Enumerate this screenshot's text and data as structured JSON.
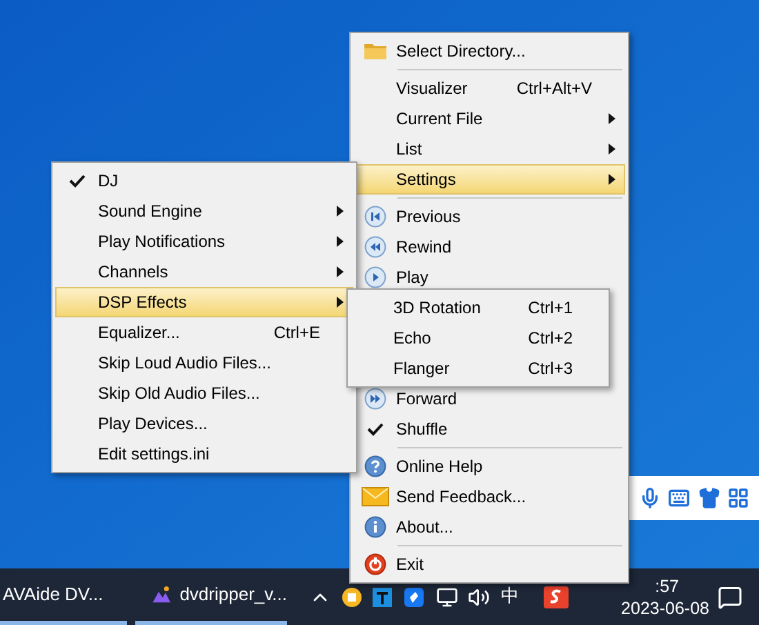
{
  "main_menu": {
    "items": [
      {
        "kind": "item",
        "label": "Select Directory...",
        "submenu": false,
        "checked": false,
        "selected": false
      },
      {
        "kind": "separator"
      },
      {
        "kind": "item",
        "label": "Visualizer",
        "shortcut": "Ctrl+Alt+V",
        "submenu": false,
        "checked": false,
        "selected": false
      },
      {
        "kind": "item",
        "label": "Current File",
        "submenu": true,
        "checked": false,
        "selected": false
      },
      {
        "kind": "item",
        "label": "List",
        "submenu": true,
        "checked": false,
        "selected": false
      },
      {
        "kind": "item",
        "label": "Settings",
        "submenu": true,
        "checked": false,
        "selected": true
      },
      {
        "kind": "separator"
      },
      {
        "kind": "item",
        "label": "Previous",
        "submenu": false,
        "checked": false,
        "selected": false
      },
      {
        "kind": "item",
        "label": "Rewind",
        "submenu": false,
        "checked": false,
        "selected": false
      },
      {
        "kind": "item",
        "label": "Play",
        "submenu": false,
        "checked": false,
        "selected": false
      },
      {
        "kind": "item",
        "label": "Forward",
        "submenu": false,
        "checked": false,
        "selected": false
      },
      {
        "kind": "item",
        "label": "Shuffle",
        "submenu": false,
        "checked": true,
        "selected": false
      },
      {
        "kind": "separator"
      },
      {
        "kind": "item",
        "label": "Online Help",
        "submenu": false,
        "checked": false,
        "selected": false
      },
      {
        "kind": "item",
        "label": "Send Feedback...",
        "submenu": false,
        "checked": false,
        "selected": false
      },
      {
        "kind": "item",
        "label": "About...",
        "submenu": false,
        "checked": false,
        "selected": false
      },
      {
        "kind": "separator"
      },
      {
        "kind": "item",
        "label": "Exit",
        "submenu": false,
        "checked": false,
        "selected": false
      }
    ]
  },
  "settings_menu": {
    "items": [
      {
        "kind": "item",
        "label": "DJ",
        "submenu": false,
        "checked": true,
        "selected": false
      },
      {
        "kind": "item",
        "label": "Sound Engine",
        "submenu": true,
        "checked": false,
        "selected": false
      },
      {
        "kind": "item",
        "label": "Play Notifications",
        "submenu": true,
        "checked": false,
        "selected": false
      },
      {
        "kind": "item",
        "label": "Channels",
        "submenu": true,
        "checked": false,
        "selected": false
      },
      {
        "kind": "item",
        "label": "DSP Effects",
        "submenu": true,
        "checked": false,
        "selected": true
      },
      {
        "kind": "item",
        "label": "Equalizer...",
        "shortcut": "Ctrl+E",
        "submenu": false,
        "checked": false,
        "selected": false
      },
      {
        "kind": "item",
        "label": "Skip Loud Audio Files...",
        "submenu": false,
        "checked": false,
        "selected": false
      },
      {
        "kind": "item",
        "label": "Skip Old Audio Files...",
        "submenu": false,
        "checked": false,
        "selected": false
      },
      {
        "kind": "item",
        "label": "Play Devices...",
        "submenu": false,
        "checked": false,
        "selected": false
      },
      {
        "kind": "item",
        "label": "Edit settings.ini",
        "submenu": false,
        "checked": false,
        "selected": false
      }
    ]
  },
  "dsp_menu": {
    "items": [
      {
        "kind": "item",
        "label": "3D Rotation",
        "shortcut": "Ctrl+1",
        "submenu": false,
        "checked": false,
        "selected": false
      },
      {
        "kind": "item",
        "label": "Echo",
        "shortcut": "Ctrl+2",
        "submenu": false,
        "checked": false,
        "selected": false
      },
      {
        "kind": "item",
        "label": "Flanger",
        "shortcut": "Ctrl+3",
        "submenu": false,
        "checked": false,
        "selected": false
      }
    ]
  },
  "taskbar": {
    "tasks": [
      {
        "label": "AVAide DV..."
      },
      {
        "label": "dvdripper_v..."
      }
    ],
    "input_method": "中",
    "time": ":57",
    "date": "2023-06-08"
  }
}
